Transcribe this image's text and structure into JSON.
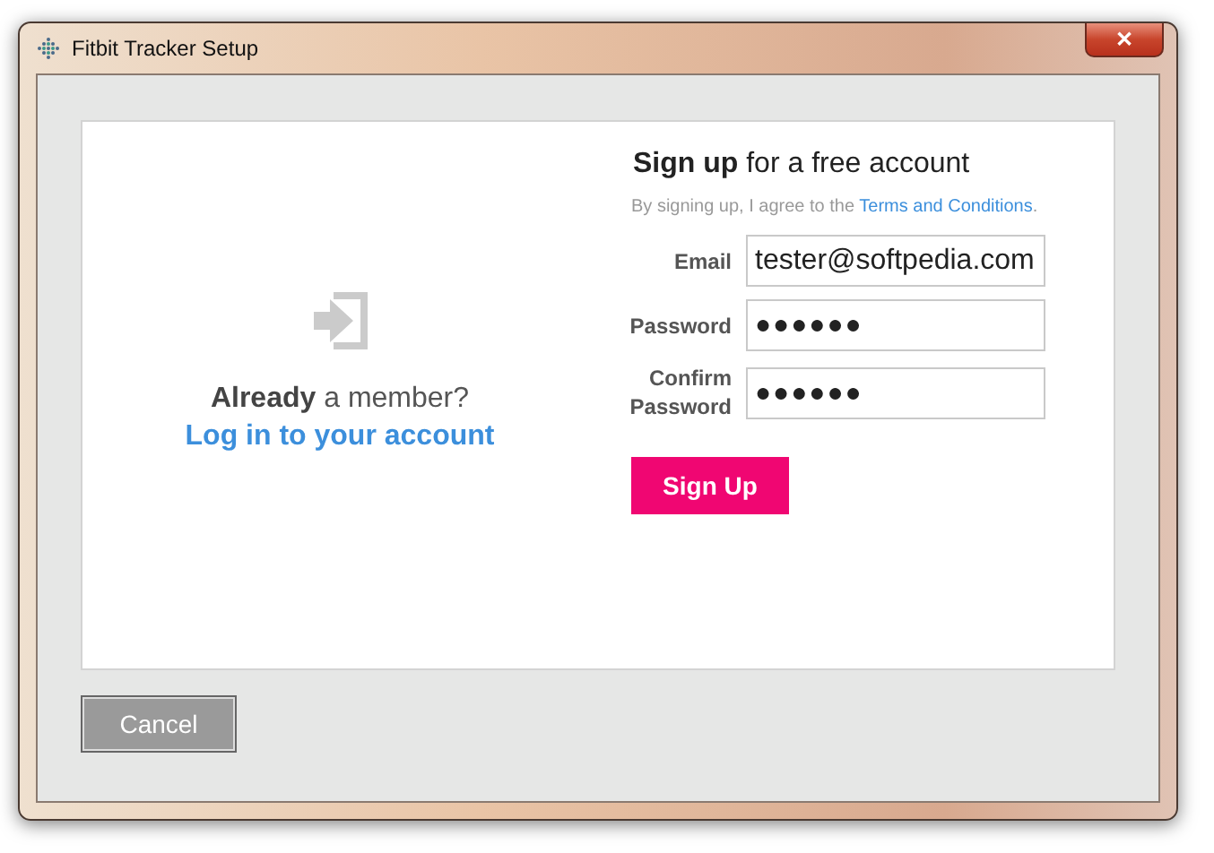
{
  "window": {
    "title": "Fitbit Tracker Setup",
    "close": "✕"
  },
  "login": {
    "prompt": "**Already** a member?",
    "link": "Log in to your account"
  },
  "signup": {
    "heading": "**Sign up** for a free account",
    "terms_prefix": "By signing up, I agree to the",
    "terms_link": "Terms and Conditions",
    "terms_suffix": ".",
    "fields": [
      {
        "label": "Email",
        "value": "tester@softpedia.com",
        "kind": "text"
      },
      {
        "label": "Password",
        "value": "●●●●●●",
        "kind": "secret"
      },
      {
        "label": "Confirm Password",
        "value": "●●●●●●",
        "kind": "secret"
      }
    ],
    "button": "Sign Up"
  },
  "cancel": "Cancel"
}
